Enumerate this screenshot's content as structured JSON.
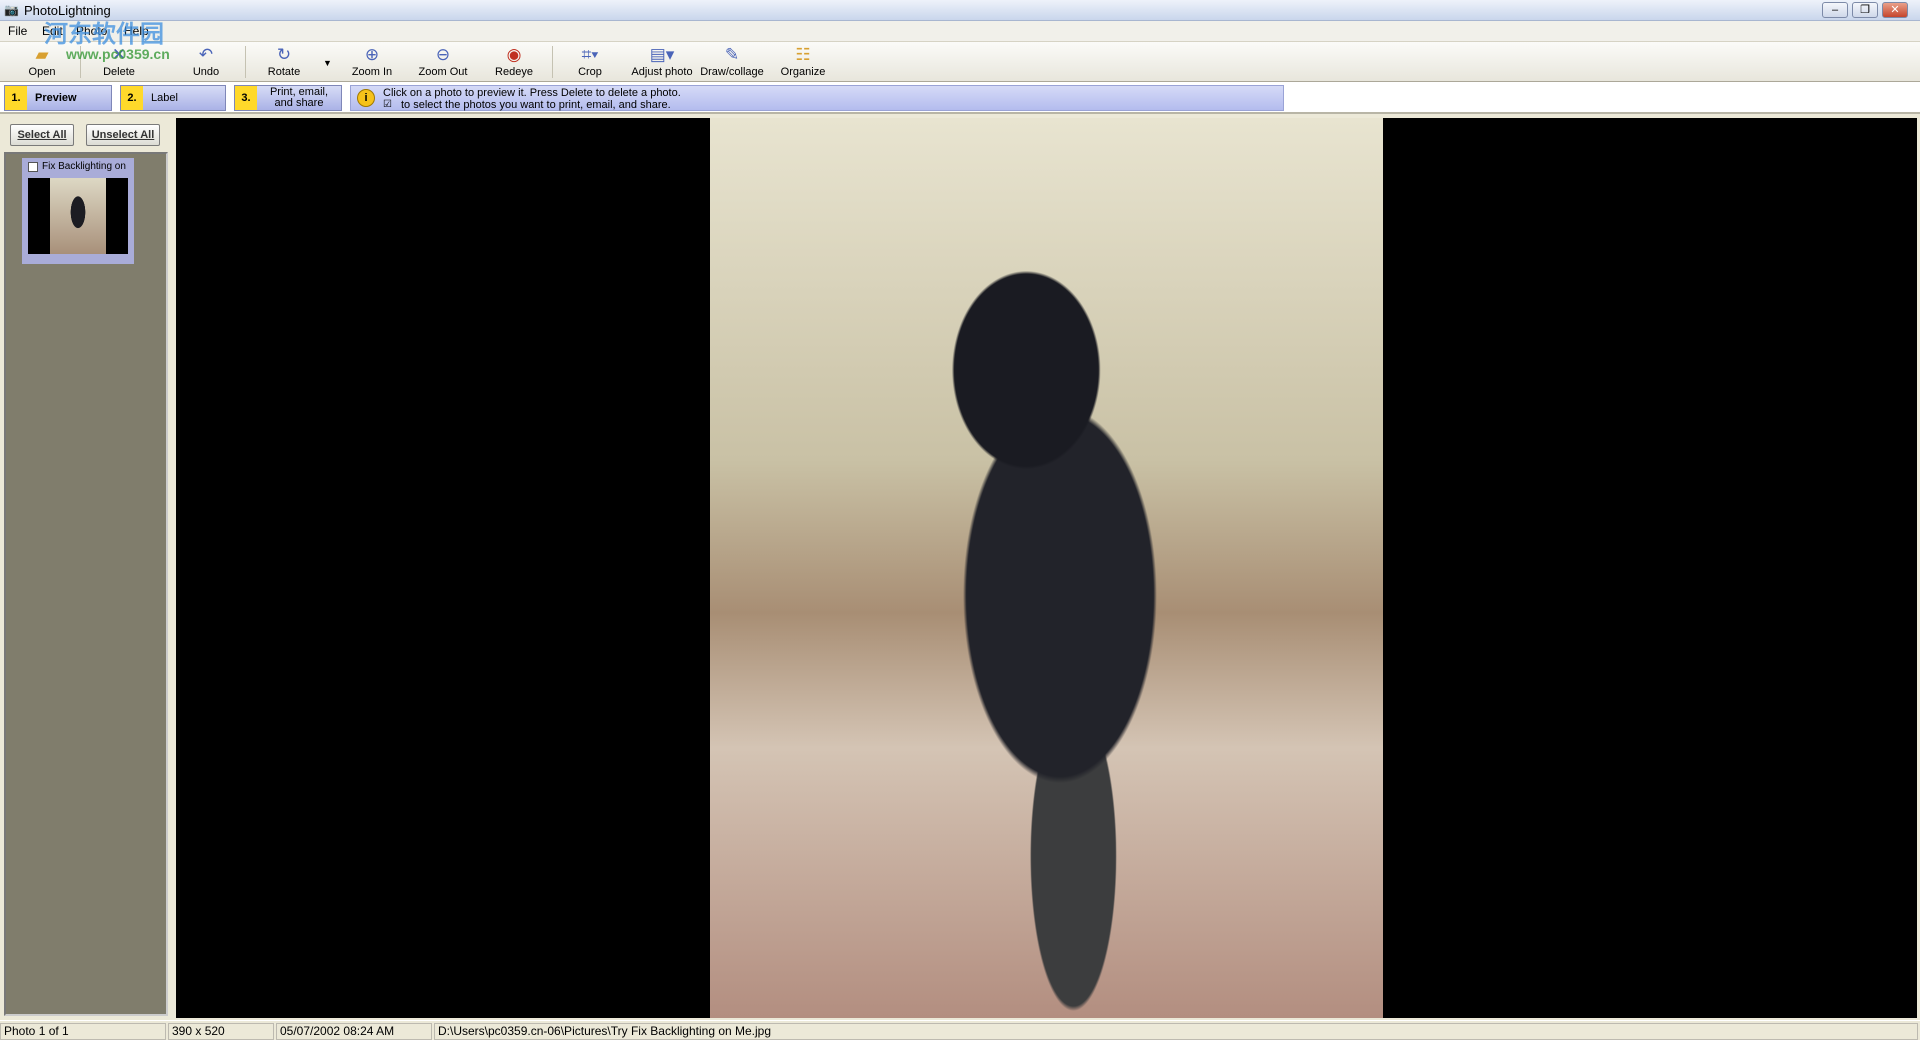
{
  "window": {
    "title": "PhotoLightning"
  },
  "menu": [
    "File",
    "Edit",
    "Photo",
    "Help"
  ],
  "toolbar": [
    {
      "label": "Open",
      "icon": "folder-open-icon"
    },
    {
      "label": "Delete",
      "icon": "delete-x-icon"
    },
    {
      "label": "Undo",
      "icon": "undo-icon"
    },
    {
      "label": "Rotate",
      "icon": "rotate-icon"
    },
    {
      "label": "Zoom In",
      "icon": "zoom-in-icon"
    },
    {
      "label": "Zoom Out",
      "icon": "zoom-out-icon"
    },
    {
      "label": "Redeye",
      "icon": "redeye-icon"
    },
    {
      "label": "Crop",
      "icon": "crop-icon"
    },
    {
      "label": "Adjust photo",
      "icon": "adjust-photo-icon"
    },
    {
      "label": "Draw/collage",
      "icon": "draw-collage-icon"
    },
    {
      "label": "Organize",
      "icon": "organize-icon"
    }
  ],
  "steps": [
    {
      "num": "1.",
      "label": "Preview"
    },
    {
      "num": "2.",
      "label": "Label"
    },
    {
      "num": "3.",
      "label": "Print, email, and share"
    }
  ],
  "info": {
    "line1": "Click on a photo to preview it.  Press Delete to delete a photo.",
    "line2": "to select the photos you want to print, email, and share."
  },
  "left": {
    "select_all": "Select All",
    "unselect_all": "Unselect All",
    "thumb_label": "Fix Backlighting on"
  },
  "status": {
    "count": "Photo 1 of 1",
    "dimensions": "390 x 520",
    "date": "05/07/2002  08:24 AM",
    "path": "D:\\Users\\pc0359.cn-06\\Pictures\\Try Fix Backlighting on Me.jpg"
  },
  "watermark": {
    "text": "河东软件园",
    "url": "www.pc0359.cn"
  }
}
